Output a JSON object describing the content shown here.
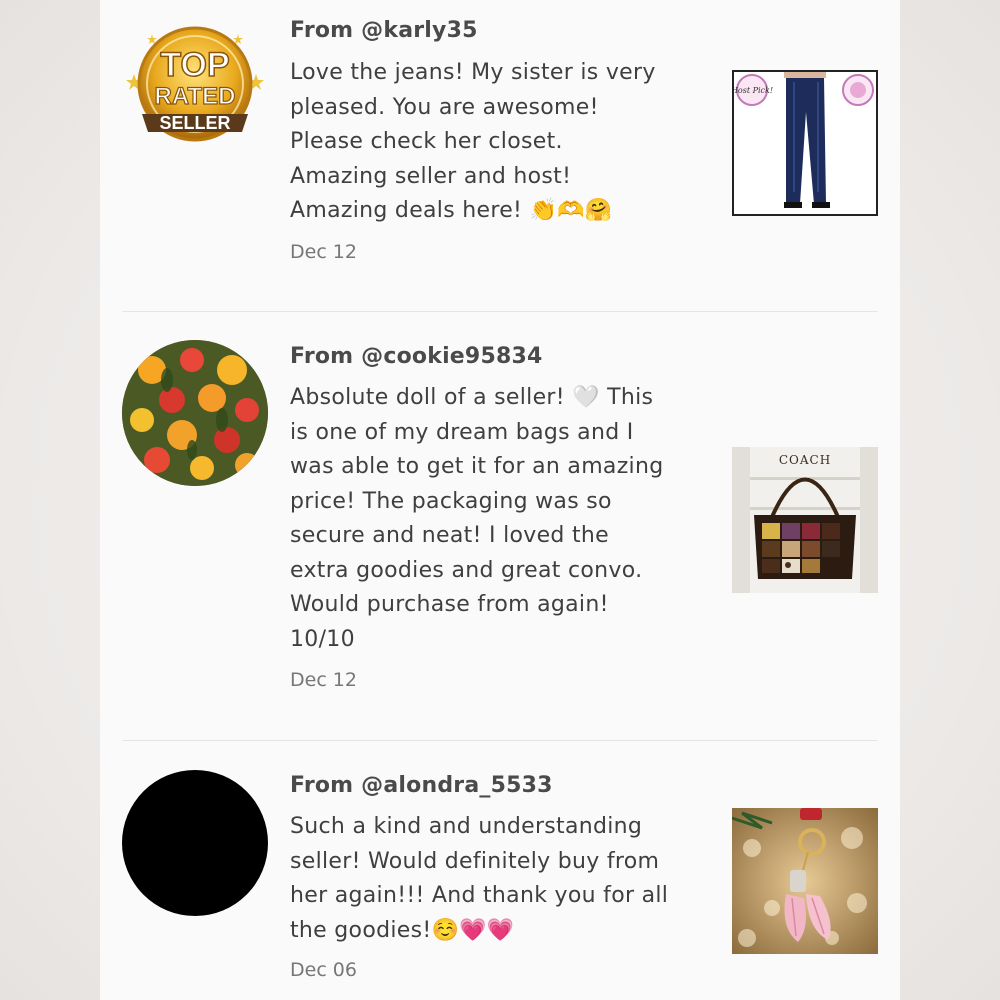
{
  "reviews": [
    {
      "from": "From @karly35",
      "lines": [
        "Love the jeans! My sister is very",
        "pleased. You are awesome!",
        "Please check her closet.",
        "Amazing seller and host!",
        "Amazing deals here! 👏🫶🤗"
      ],
      "date": "Dec 12",
      "avatar": "top-rated-seller-badge",
      "badge": {
        "line1": "TOP",
        "line2": "RATED",
        "line3": "SELLER"
      },
      "thumb": "jeans",
      "thumb_text": {
        "host": "Host Pick!"
      }
    },
    {
      "from": "From @cookie95834",
      "lines": [
        "Absolute doll of a seller! 🤍 This",
        "is one of my dream bags and I",
        "was able to get it for an amazing",
        "price! The packaging was so",
        "secure and neat! I loved the",
        "extra goodies and great convo.",
        "Would purchase from again!",
        "10/10"
      ],
      "date": "Dec 12",
      "avatar": "flowers",
      "thumb": "coach-bag",
      "thumb_text": {
        "brand": "COACH"
      }
    },
    {
      "from": "From @alondra_5533",
      "lines": [
        "Such a kind and understanding",
        "seller! Would definitely buy from",
        "her again!!! And thank you for all",
        "the goodies!☺️💗💗"
      ],
      "date": "Dec 06",
      "avatar": "black-circle",
      "thumb": "keychain"
    }
  ]
}
